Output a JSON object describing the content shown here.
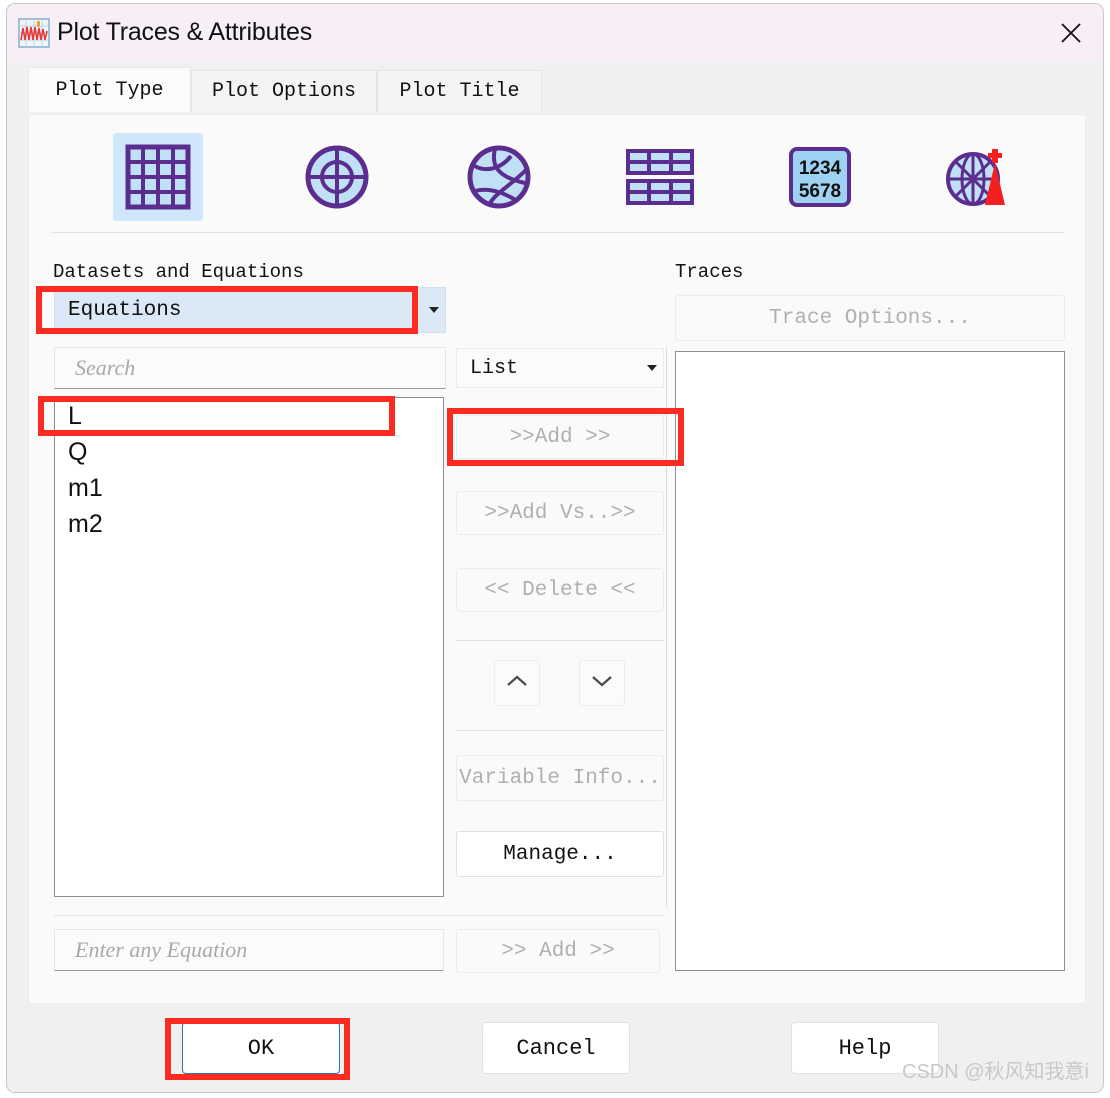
{
  "window": {
    "title": "Plot Traces & Attributes",
    "icon": "waveform-plot-icon",
    "close_label": "×"
  },
  "tabs": [
    {
      "label": "Plot Type",
      "active": true
    },
    {
      "label": "Plot Options",
      "active": false
    },
    {
      "label": "Plot Title",
      "active": false
    }
  ],
  "plot_types": [
    {
      "name": "grid-plot-icon",
      "selected": true
    },
    {
      "name": "polar-target-plot-icon",
      "selected": false
    },
    {
      "name": "sphere-plot-icon",
      "selected": false
    },
    {
      "name": "double-table-plot-icon",
      "selected": false
    },
    {
      "name": "numeric-table-plot-icon",
      "selected": false
    },
    {
      "name": "antenna-radiation-plot-icon",
      "selected": false
    }
  ],
  "left_panel": {
    "heading": "Datasets and Equations",
    "source_combo": {
      "value": "Equations",
      "arrow": "chevron-down-icon"
    },
    "search": {
      "value": "",
      "placeholder": "Search"
    },
    "items": [
      "L",
      "Q",
      "m1",
      "m2"
    ],
    "selected_item": "L",
    "equation_input": {
      "value": "",
      "placeholder": "Enter any Equation"
    },
    "equation_add_button": {
      "label": ">> Add >>",
      "enabled": false
    }
  },
  "middle_panel": {
    "mode_combo": {
      "value": "List",
      "arrow": "chevron-down-icon"
    },
    "buttons": [
      {
        "label": ">>Add >>",
        "enabled": false,
        "name": "add-button"
      },
      {
        "label": ">>Add Vs..>>",
        "enabled": false,
        "name": "add-vs-button"
      },
      {
        "label": "<< Delete <<",
        "enabled": false,
        "name": "delete-button"
      }
    ],
    "move_up": {
      "icon": "chevron-up-icon"
    },
    "move_down": {
      "icon": "chevron-down-icon"
    },
    "variable_info_button": {
      "label": "Variable Info...",
      "enabled": false
    },
    "manage_button": {
      "label": "Manage...",
      "enabled": true
    }
  },
  "right_panel": {
    "heading": "Traces",
    "trace_options_button": {
      "label": "Trace Options...",
      "enabled": false
    },
    "items": []
  },
  "footer": {
    "ok_label": "OK",
    "cancel_label": "Cancel",
    "help_label": "Help"
  },
  "watermark": "CSDN @秋风知我意i",
  "colors": {
    "titlebar": "#f8eef6",
    "accent_selection": "#cfe6fb",
    "combo_selected_bg": "#dbe8f5",
    "annotation_red": "#fb2b21",
    "default_button_border": "#2878b4",
    "icon_purple": "#5b2d8e",
    "icon_red": "#f41f1f"
  }
}
